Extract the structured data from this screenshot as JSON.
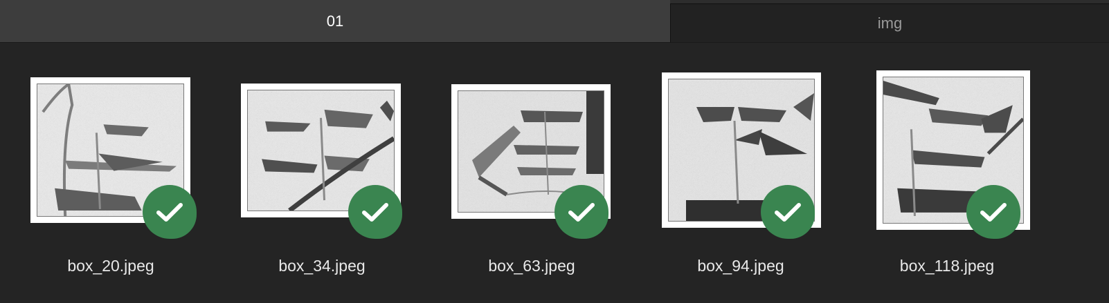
{
  "tabs": [
    {
      "label": "01",
      "active": true
    },
    {
      "label": "img",
      "active": false
    }
  ],
  "colors": {
    "background": "#242424",
    "tab_active_bg": "#3d3d3d",
    "tab_inactive_bg": "#222222",
    "check_badge": "#3a8550",
    "text": "#e8e8e8"
  },
  "thumbnails": [
    {
      "filename": "box_20.jpeg",
      "selected": true,
      "icon": "checkmark-icon"
    },
    {
      "filename": "box_34.jpeg",
      "selected": true,
      "icon": "checkmark-icon"
    },
    {
      "filename": "box_63.jpeg",
      "selected": true,
      "icon": "checkmark-icon"
    },
    {
      "filename": "box_94.jpeg",
      "selected": true,
      "icon": "checkmark-icon"
    },
    {
      "filename": "box_118.jpeg",
      "selected": true,
      "icon": "checkmark-icon"
    }
  ]
}
